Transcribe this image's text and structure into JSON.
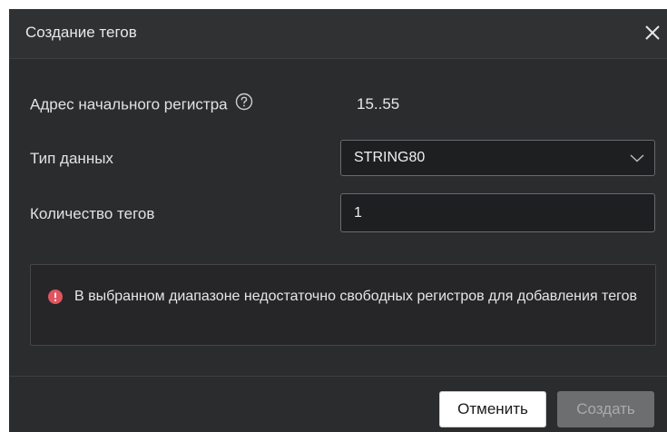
{
  "dialog": {
    "title": "Создание тегов",
    "close_icon": "close-icon"
  },
  "form": {
    "start_register_label": "Адрес начального регистра",
    "start_register_help_icon": "question-circle-icon",
    "start_register_value": "15..55",
    "data_type_label": "Тип данных",
    "data_type_selected": "STRING80",
    "data_type_icon": "chevron-down-icon",
    "tag_count_label": "Количество тегов",
    "tag_count_value": "1"
  },
  "alert": {
    "icon": "error-icon",
    "message": "В выбранном диапазоне недостаточно свободных регистров для добавления тегов",
    "color": "#e0555f"
  },
  "footer": {
    "cancel_label": "Отменить",
    "create_label": "Создать",
    "create_disabled": true
  },
  "colors": {
    "background": "#2b2c2e",
    "field_background": "#1e1f21",
    "field_border": "#6a6b6e",
    "text": "#e6e6e6"
  }
}
